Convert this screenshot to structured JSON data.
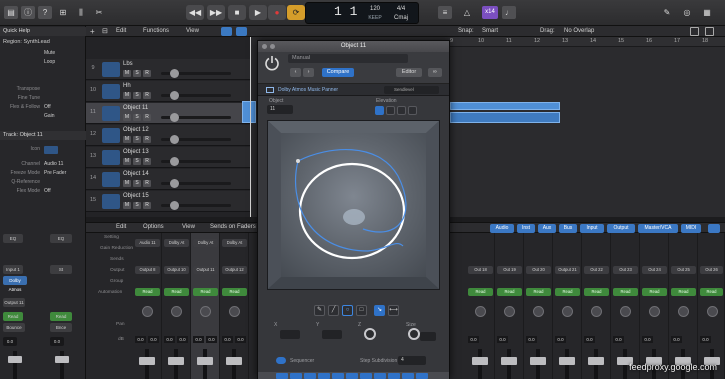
{
  "control_bar": {
    "lcd": {
      "bar_beat": "1  1",
      "tempo": "120",
      "tempo_label": "KEEP",
      "time_sig": "4/4",
      "key": "Cmaj"
    },
    "user_badge": "x14"
  },
  "inspector": {
    "title": "Quick Help",
    "region": "Region: SynthLead",
    "params": [
      {
        "k": "",
        "v": "Mute"
      },
      {
        "k": "",
        "v": "Loop"
      },
      {
        "k": "Transpose",
        "v": ""
      },
      {
        "k": "Fine Tune",
        "v": ""
      },
      {
        "k": "Flex & Follow",
        "v": "Off"
      },
      {
        "k": "",
        "v": "Gain"
      }
    ],
    "track_label": "Track: Object 11",
    "track_params": [
      {
        "k": "Icon",
        "v": ""
      },
      {
        "k": "Channel",
        "v": "Audio 11"
      },
      {
        "k": "Freeze Mode",
        "v": "Pre Fader"
      },
      {
        "k": "Q-Reference",
        "v": ""
      },
      {
        "k": "Flex Mode",
        "v": "Off"
      }
    ],
    "strip_buttons": [
      "EQ",
      "Input 1",
      "Dolby Atmos",
      "Output 11",
      "Read",
      "Bounce"
    ],
    "strip_right_buttons": [
      "EQ",
      "St",
      "Read",
      "Bnce"
    ],
    "values": [
      "0.0",
      "0.0"
    ]
  },
  "tracks_menu": [
    "Edit",
    "Functions",
    "View"
  ],
  "snap": {
    "label": "Snap:",
    "value": "Smart",
    "drag_label": "Drag:",
    "drag_value": "No Overlap"
  },
  "ruler": [
    "9",
    "10",
    "11",
    "12",
    "13",
    "14",
    "15",
    "16",
    "17",
    "18"
  ],
  "tracks": [
    {
      "num": "9",
      "name": "Lbs",
      "selected": false
    },
    {
      "num": "10",
      "name": "Hh",
      "selected": false
    },
    {
      "num": "11",
      "name": "Object 11",
      "selected": true
    },
    {
      "num": "12",
      "name": "Object 12",
      "selected": false
    },
    {
      "num": "13",
      "name": "Object 13",
      "selected": false
    },
    {
      "num": "14",
      "name": "Object 14",
      "selected": false
    },
    {
      "num": "15",
      "name": "Object 15",
      "selected": false
    }
  ],
  "track_buttons": [
    "M",
    "S",
    "R"
  ],
  "mixer_menu": [
    "Edit",
    "Options",
    "View",
    "Sends on Faders"
  ],
  "mixer_filters": [
    "Audio",
    "Inst",
    "Aux",
    "Bus",
    "Input",
    "Output",
    "Master/VCA",
    "MIDI"
  ],
  "mixer_row_labels": [
    "Setting",
    "Gain Reduction",
    "Sends",
    "Output",
    "Group",
    "Automation",
    "Pan",
    "dB"
  ],
  "mixer_strips": [
    {
      "io": "Audio 11",
      "output": "Output 8",
      "auto": "Read",
      "val": "0.0",
      "sel": false
    },
    {
      "io": "Dolby At",
      "output": "Output 10",
      "auto": "Read",
      "val": "0.0",
      "sel": false
    },
    {
      "io": "Dolby At",
      "output": "Output 11",
      "auto": "Read",
      "val": "0.0",
      "sel": true
    },
    {
      "io": "Dolby At",
      "output": "Output 12",
      "auto": "Read",
      "val": "0.0",
      "sel": false
    },
    {
      "io": "",
      "output": "Out 18",
      "auto": "Read",
      "val": "0.0",
      "sel": false
    },
    {
      "io": "",
      "output": "Out 19",
      "auto": "Read",
      "val": "0.0",
      "sel": false
    },
    {
      "io": "",
      "output": "Out 20",
      "auto": "Read",
      "val": "0.0",
      "sel": false
    },
    {
      "io": "",
      "output": "Output 21",
      "auto": "Read",
      "val": "0.0",
      "sel": false
    },
    {
      "io": "",
      "output": "Out 22",
      "auto": "Read",
      "val": "0.0",
      "sel": false
    },
    {
      "io": "",
      "output": "Out 23",
      "auto": "Read",
      "val": "0.0",
      "sel": false
    },
    {
      "io": "",
      "output": "Out 24",
      "auto": "Read",
      "val": "0.0",
      "sel": false
    },
    {
      "io": "",
      "output": "Out 25",
      "auto": "Read",
      "val": "0.0",
      "sel": false
    },
    {
      "io": "",
      "output": "Out 26",
      "auto": "Read",
      "val": "0.0",
      "sel": false
    },
    {
      "io": "",
      "output": "Out 27",
      "auto": "Read",
      "val": "0.0",
      "sel": false
    }
  ],
  "plugin": {
    "title": "Object 11",
    "preset": "Manual",
    "compare": "Compare",
    "editor": "Editor",
    "subtitle": "Dolby Atmos Music Panner",
    "sub_right": "Sendlevel",
    "object_label": "Object",
    "object_value": "11",
    "elevation_label": "Elevation",
    "bottom_labels": [
      "X",
      "Y",
      "Z",
      "Size"
    ],
    "sequencer_label": "Sequencer",
    "step_label": "Step Subdivision",
    "step_value": "4"
  },
  "watermark": "feedproxy.google.com"
}
